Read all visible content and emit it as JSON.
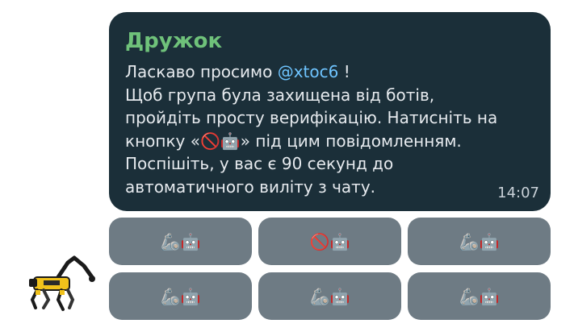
{
  "message": {
    "sender": "Дружок",
    "greeting_before": "Ласкаво просимо ",
    "mention": "@xtoc6",
    "greeting_after": " !",
    "body": "Щоб група була захищена від ботів,\nпройдіть просту верифікацію. Натисніть на\nкнопку «🚫🤖» під цим повідомленням.\nПоспішіть, у вас є 90 секунд до\nавтоматичного виліту з чату.",
    "time": "14:07"
  },
  "buttons": [
    {
      "label": "🦾🤖"
    },
    {
      "label": "🚫🤖"
    },
    {
      "label": "🦾🤖"
    },
    {
      "label": "🦾🤖"
    },
    {
      "label": "🦾🤖"
    },
    {
      "label": "🦾🤖"
    }
  ],
  "colors": {
    "bubble": "#1b2f39",
    "sender": "#6fc27a",
    "mention": "#6ec4ff",
    "button": "#6e7b84"
  },
  "avatar": {
    "icon": "robot-dog-icon"
  }
}
